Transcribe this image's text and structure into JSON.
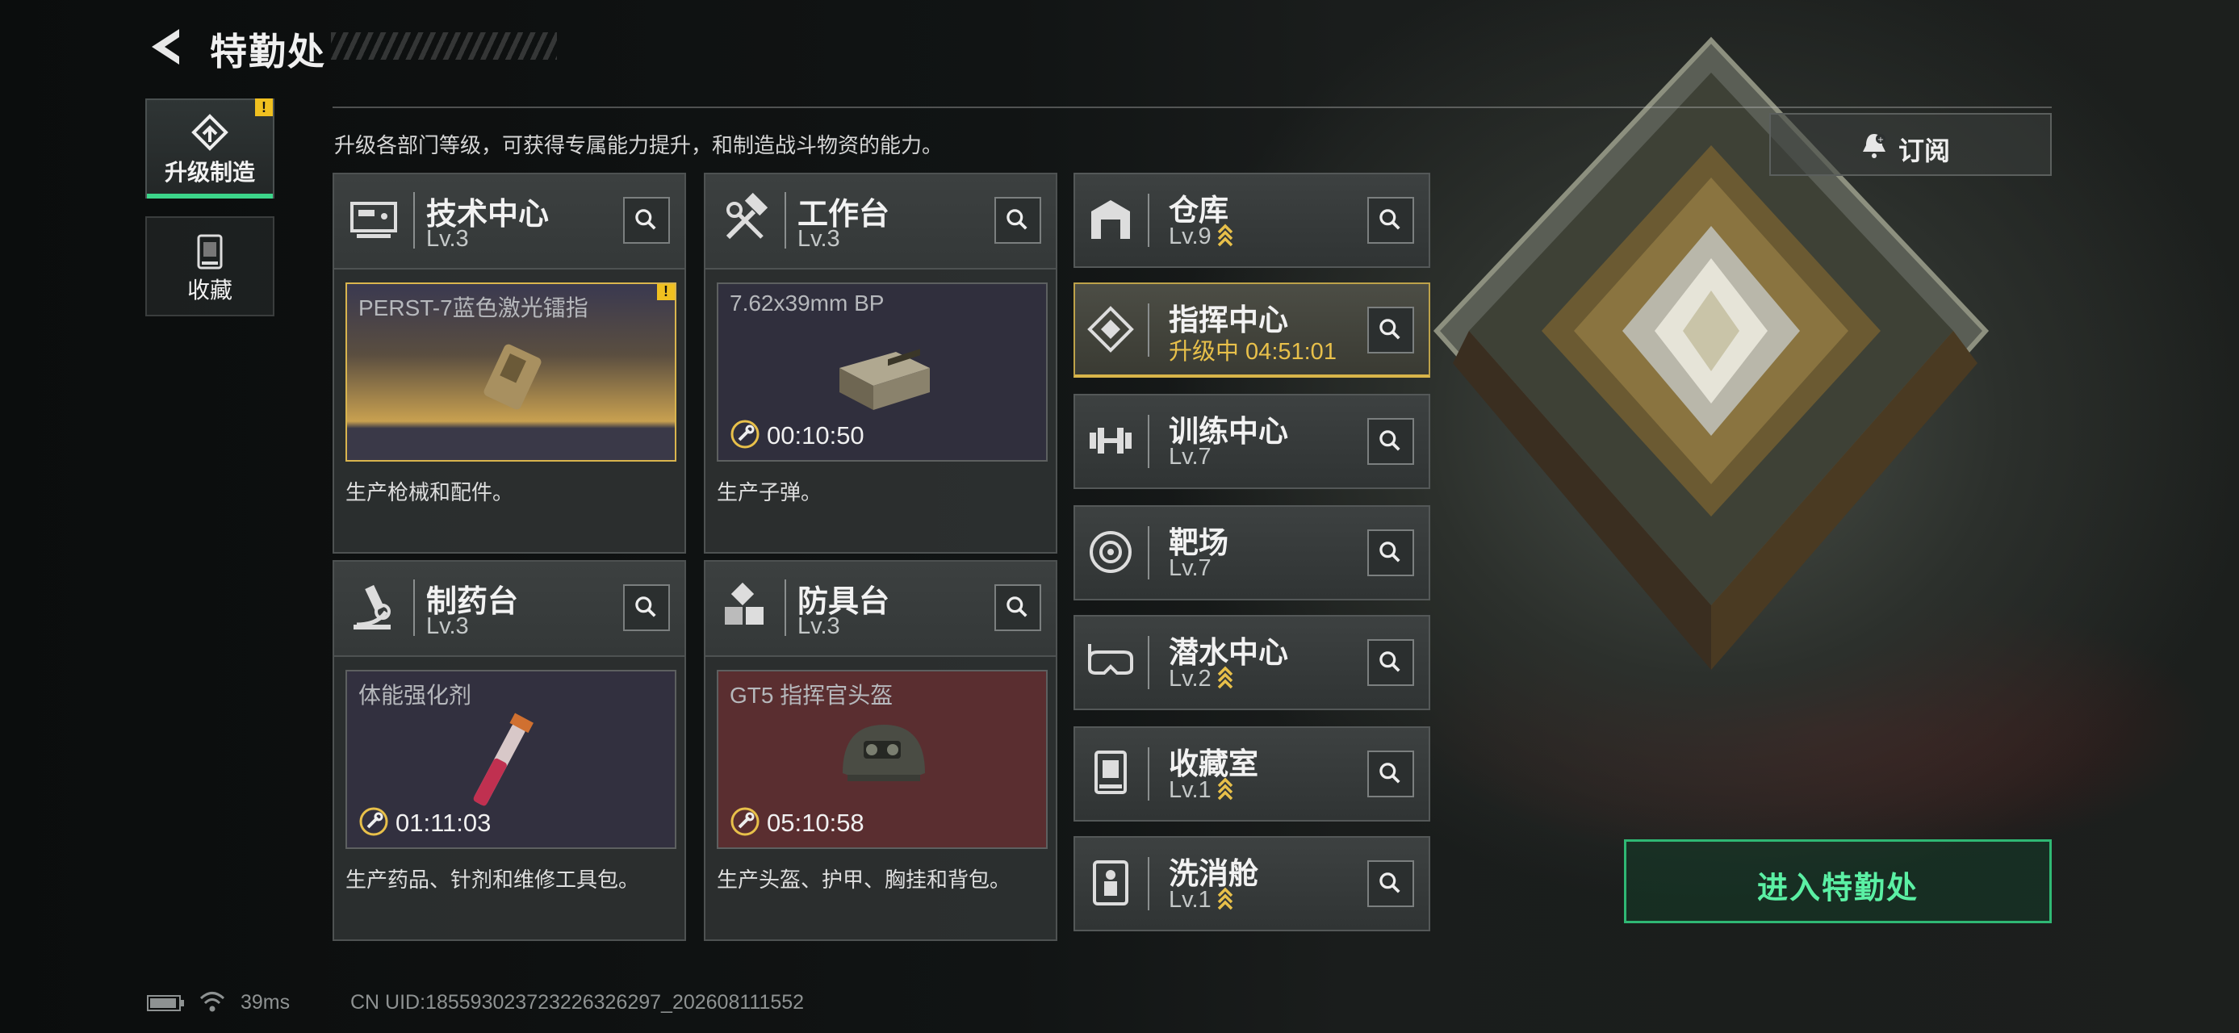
{
  "header": {
    "title": "特勤处"
  },
  "nav": {
    "tabs": [
      {
        "label": "升级制造",
        "active": true,
        "alert": "!"
      },
      {
        "label": "收藏",
        "active": false
      }
    ]
  },
  "description": "升级各部门等级，可获得专属能力提升，和制造战斗物资的能力。",
  "subscribe": {
    "label": "订阅",
    "icon": "bell-icon"
  },
  "facilities": [
    {
      "name": "技术中心",
      "level": "Lv.3",
      "icon": "computer-icon",
      "slot": {
        "item": "PERST-7蓝色激光镭指",
        "timer": "",
        "alert": "!"
      },
      "description": "生产枪械和配件。"
    },
    {
      "name": "工作台",
      "level": "Lv.3",
      "icon": "hammer-wrench-icon",
      "slot": {
        "item": "7.62x39mm BP",
        "timer": "00:10:50"
      },
      "description": "生产子弹。"
    },
    {
      "name": "制药台",
      "level": "Lv.3",
      "icon": "microscope-icon",
      "slot": {
        "item": "体能强化剂",
        "timer": "01:11:03"
      },
      "description": "生产药品、针剂和维修工具包。"
    },
    {
      "name": "防具台",
      "level": "Lv.3",
      "icon": "blocks-icon",
      "slot": {
        "item": "GT5 指挥官头盔",
        "timer": "05:10:58"
      },
      "description": "生产头盔、护甲、胸挂和背包。"
    }
  ],
  "rooms": [
    {
      "name": "仓库",
      "level": "Lv.9",
      "upgradable": true,
      "icon": "warehouse-icon"
    },
    {
      "name": "指挥中心",
      "status": "升级中 04:51:01",
      "upgrading": true,
      "icon": "command-icon"
    },
    {
      "name": "训练中心",
      "level": "Lv.7",
      "upgradable": false,
      "icon": "dumbbell-icon"
    },
    {
      "name": "靶场",
      "level": "Lv.7",
      "upgradable": false,
      "icon": "target-icon"
    },
    {
      "name": "潜水中心",
      "level": "Lv.2",
      "upgradable": true,
      "icon": "diving-mask-icon"
    },
    {
      "name": "收藏室",
      "level": "Lv.1",
      "upgradable": true,
      "icon": "collection-icon"
    },
    {
      "name": "洗消舱",
      "level": "Lv.1",
      "upgradable": true,
      "icon": "decon-icon"
    }
  ],
  "enter_button": {
    "label": "进入特勤处"
  },
  "status_bar": {
    "ping": "39ms",
    "uid": "CN UID:18559302372322632629​7_202608111552"
  },
  "colors": {
    "accent_green": "#3cd58a",
    "upgrade_gold": "#e8c04a",
    "alert_yellow": "#f0c020"
  }
}
